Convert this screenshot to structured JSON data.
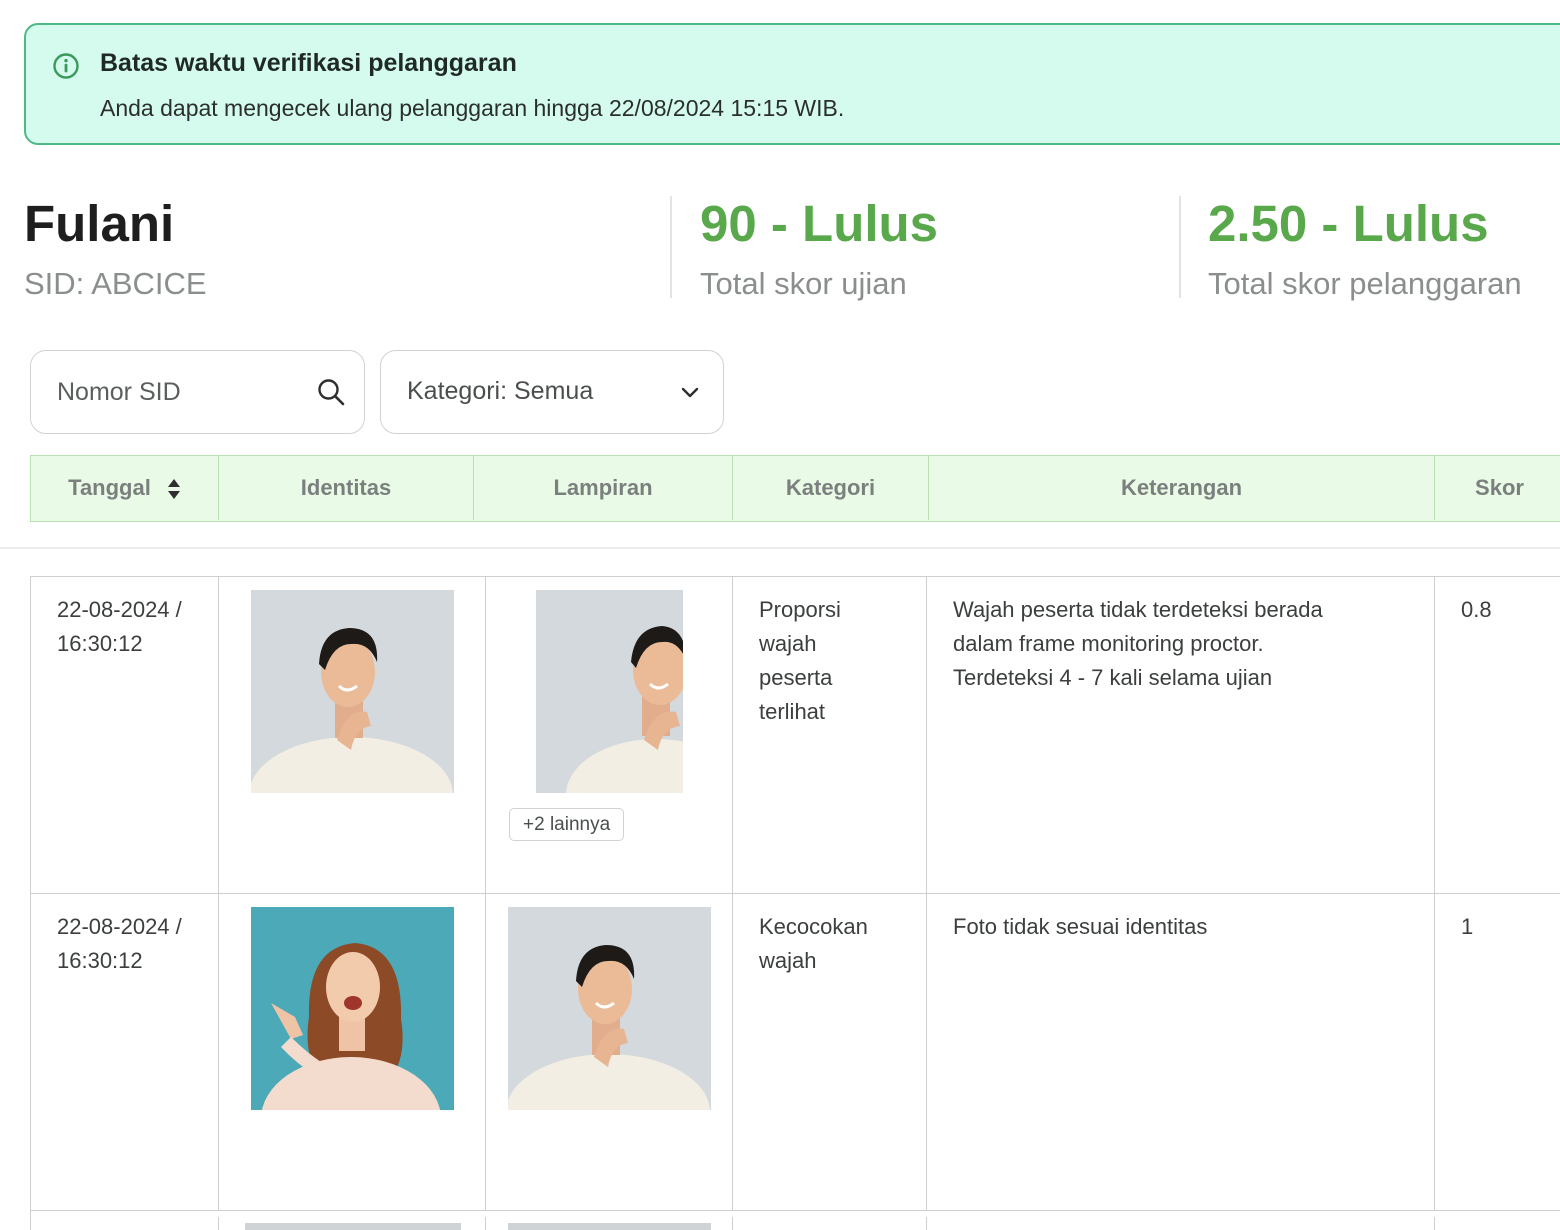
{
  "alert": {
    "title": "Batas waktu verifikasi pelanggaran",
    "message": "Anda dapat mengecek ulang pelanggaran hingga 22/08/2024 15:15 WIB.",
    "icon": "info-icon",
    "accent": "#4fb887"
  },
  "summary": {
    "name": "Fulani",
    "sid": "SID: ABCICE",
    "exam_score": "90 - Lulus",
    "exam_score_label": "Total skor ujian",
    "violation_score": "2.50 - Lulus",
    "violation_score_label": "Total skor pelanggaran",
    "score_color": "#5aa84c"
  },
  "filters": {
    "search_placeholder": "Nomor SID",
    "category_label": "Kategori: Semua"
  },
  "table": {
    "columns": [
      "Tanggal",
      "Identitas",
      "Lampiran",
      "Kategori",
      "Keterangan",
      "Skor"
    ],
    "rows": [
      {
        "date": "22-08-2024 /",
        "time": "16:30:12",
        "more": "+2 lainnya",
        "category": [
          "Proporsi",
          "wajah",
          "peserta",
          "terlihat"
        ],
        "description": [
          "Wajah peserta tidak terdeteksi berada",
          "dalam frame monitoring proctor.",
          "Terdeteksi 4 - 7 kali selama ujian"
        ],
        "score": "0.8"
      },
      {
        "date": "22-08-2024 /",
        "time": "16:30:12",
        "category": [
          "Kecocokan",
          "wajah"
        ],
        "description": [
          "Foto tidak sesuai identitas"
        ],
        "score": "1"
      }
    ]
  }
}
